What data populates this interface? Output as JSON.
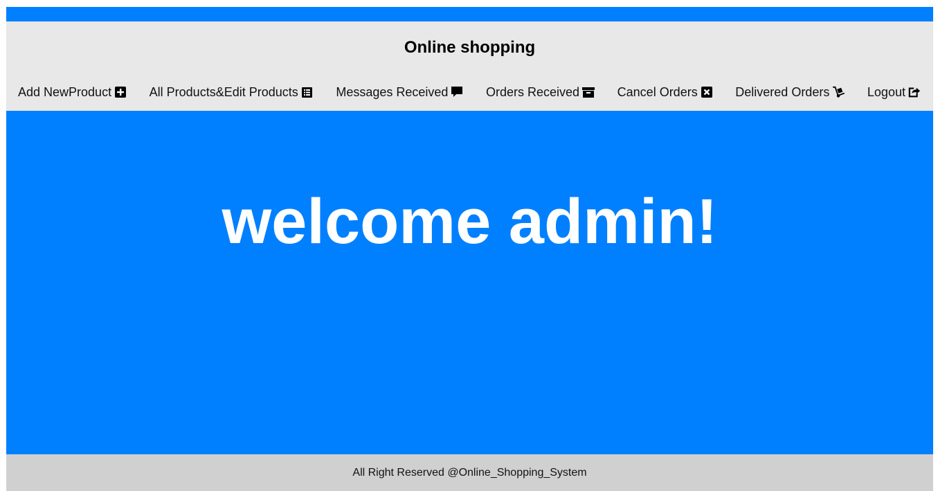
{
  "header": {
    "title": "Online shopping"
  },
  "nav": {
    "items": [
      {
        "label": "Add NewProduct",
        "icon": "plus-square-icon"
      },
      {
        "label": "All Products&Edit Products",
        "icon": "list-alt-icon"
      },
      {
        "label": "Messages Received",
        "icon": "comment-icon"
      },
      {
        "label": "Orders Received",
        "icon": "archive-icon"
      },
      {
        "label": "Cancel Orders",
        "icon": "close-square-icon"
      },
      {
        "label": "Delivered Orders",
        "icon": "dolly-icon"
      },
      {
        "label": "Logout",
        "icon": "share-square-icon"
      }
    ]
  },
  "hero": {
    "text": "welcome admin!"
  },
  "footer": {
    "text": "All Right Reserved @Online_Shopping_System"
  },
  "colors": {
    "accent": "#0080ff",
    "header_bg": "#e8e8e8",
    "footer_bg": "#d0d0d0"
  }
}
